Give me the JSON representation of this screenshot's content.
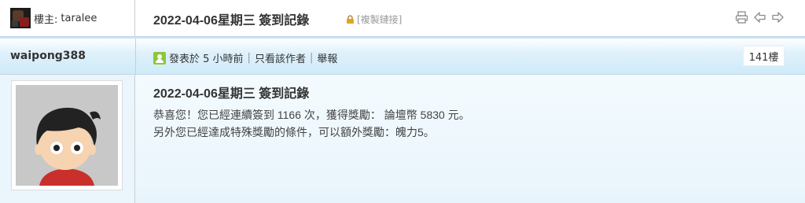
{
  "header": {
    "owner_label": "樓主:",
    "owner_name": "taralee",
    "thread_title": "2022-04-06星期三 簽到記錄",
    "copy_link": "[複製鏈接]",
    "icons": [
      "print-icon",
      "previous-thread-icon",
      "next-thread-icon"
    ]
  },
  "author_bar": {
    "author_name": "waipong388",
    "posted_time": "發表於 5 小時前",
    "only_author": "只看該作者",
    "report": "舉報",
    "floor": "141樓",
    "online_icon_color": "#8cc63e"
  },
  "post": {
    "title": "2022-04-06星期三 簽到記錄",
    "line1": "恭喜您！您已經連續簽到 1166 次，獲得獎勵： 論壇幣 5830 元。",
    "line2": "另外您已經達成特殊獎勵的條件，可以額外獎勵：魄力5。"
  },
  "colors": {
    "border": "#c2d5e3",
    "author_bar_bg": "#cfeaf9",
    "body_bg": "#eaf5fc",
    "muted_text": "#999999"
  }
}
